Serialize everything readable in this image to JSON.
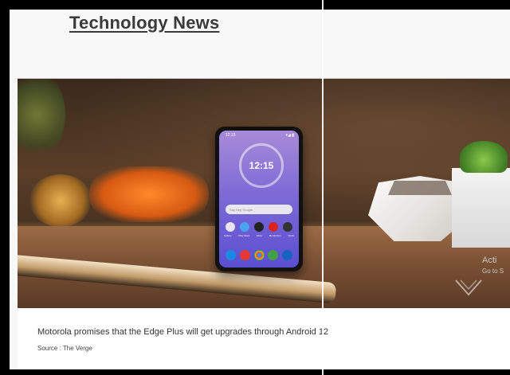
{
  "page": {
    "heading": "Technology News"
  },
  "article": {
    "caption": "Motorola promises that the Edge Plus will get upgrades through Android 12",
    "source": "Source : The Verge"
  },
  "phone_screen": {
    "time": "12:15",
    "search_placeholder": "Say Hey Google",
    "status_left": "12:15",
    "status_right": "▾◢ ▮",
    "app_labels": [
      "Gallery",
      "Play Store",
      "Moto",
      "My Verizon",
      "Clock"
    ]
  },
  "os_overlay": {
    "activate_title": "Acti",
    "activate_sub": "Go to S"
  },
  "colors": {
    "heading_color": "#3a3a3a",
    "screen_accent": "#7e6bd6"
  }
}
